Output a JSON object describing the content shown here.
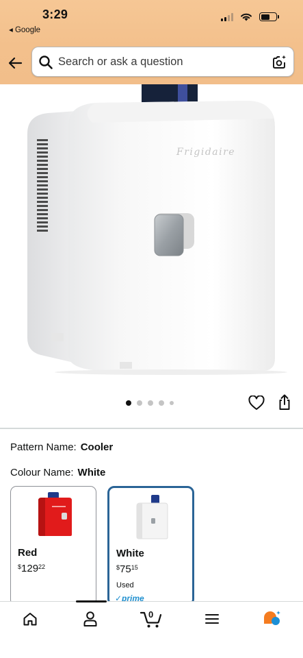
{
  "status_bar": {
    "time": "3:29",
    "back_app_label": "◂ Google"
  },
  "header": {
    "back_icon": "arrow-left-icon",
    "search": {
      "placeholder": "Search or ask a question",
      "value": ""
    },
    "lens_icon": "camera-lens-sparkle-icon"
  },
  "product": {
    "brand_text_on_image": "Frigidaire",
    "image_count": 5,
    "active_image_index": 0
  },
  "variations": {
    "pattern_label": "Pattern Name:",
    "pattern_value": "Cooler",
    "colour_label": "Colour Name:",
    "colour_value": "White",
    "options": [
      {
        "name": "Red",
        "price_currency": "$",
        "price_whole": "129",
        "price_fraction": "22",
        "condition": "",
        "prime": ""
      },
      {
        "name": "White",
        "price_currency": "$",
        "price_whole": "75",
        "price_fraction": "15",
        "condition": "Used",
        "prime": "✓prime"
      }
    ]
  },
  "bottom_nav": {
    "cart_count": "0",
    "items": [
      "home-icon",
      "account-icon",
      "cart-icon",
      "menu-icon",
      "rufus-icon"
    ],
    "active_index": 1
  },
  "colors": {
    "header_bg": "#f3c08c",
    "selected_border": "#2a6496",
    "prime_blue": "#1f8fcf",
    "rufus_orange": "#f47c20",
    "rufus_blue": "#1b8fd6"
  }
}
